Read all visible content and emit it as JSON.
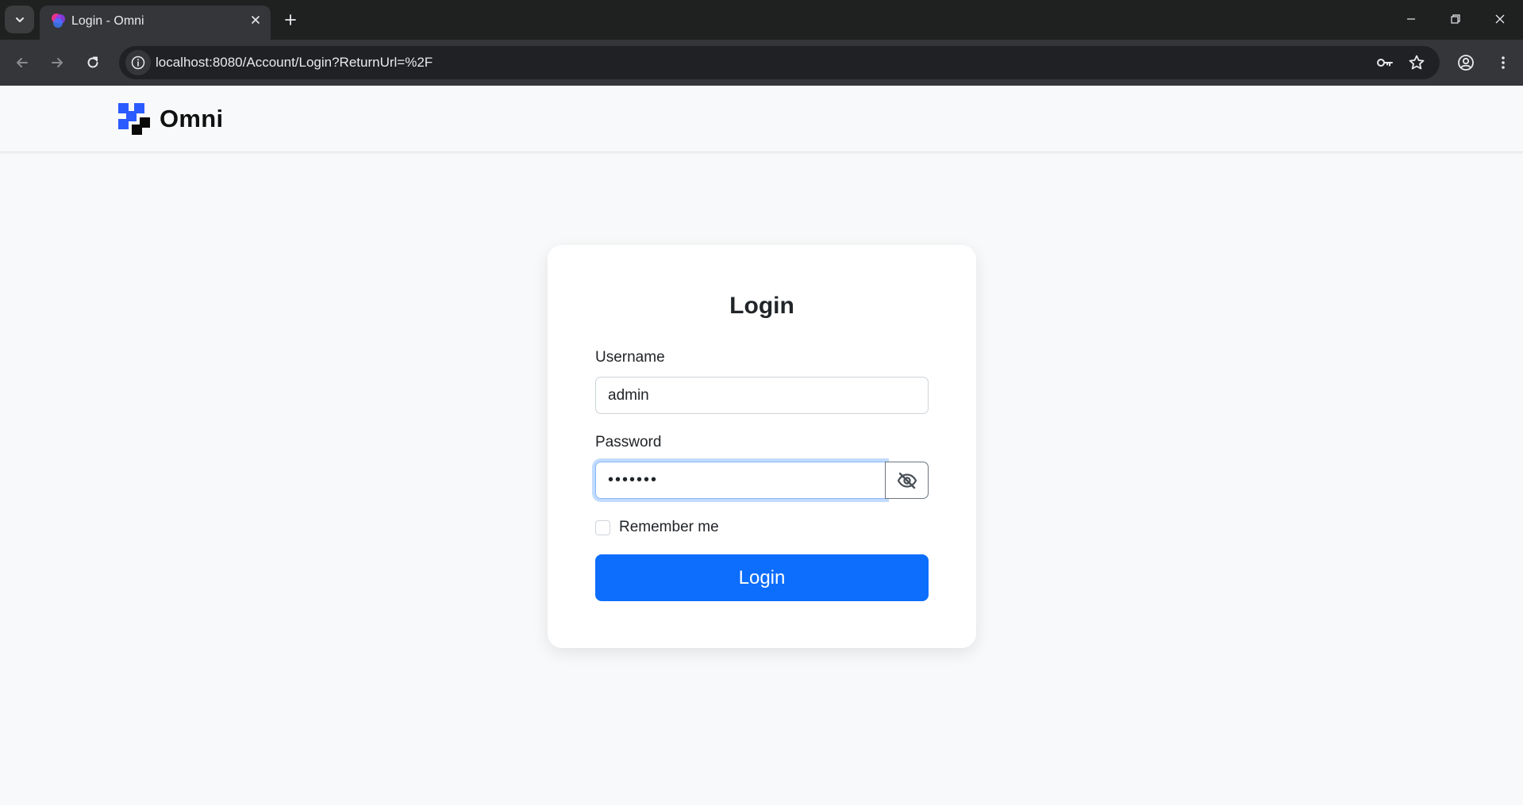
{
  "browser": {
    "tab": {
      "title": "Login - Omni"
    },
    "address_bar": {
      "url": "localhost:8080/Account/Login?ReturnUrl=%2F"
    },
    "icons": {
      "tab_search": "chevron-down-icon",
      "tab_close": "close-icon",
      "new_tab": "plus-icon",
      "minimize": "minimize-icon",
      "restore": "restore-icon",
      "window_close": "close-icon",
      "back": "arrow-left-icon",
      "forward": "arrow-right-icon",
      "reload": "reload-icon",
      "site_info": "info-icon",
      "password_manager": "key-icon",
      "bookmark": "star-icon",
      "profile": "profile-icon",
      "menu": "kebab-menu-icon"
    }
  },
  "navbar": {
    "brand": "Omni",
    "logo_colors": {
      "blue": "#2b5bff",
      "black": "#0a0a0a"
    }
  },
  "login": {
    "title": "Login",
    "username": {
      "label": "Username",
      "value": "admin"
    },
    "password": {
      "label": "Password",
      "value": "•••••••",
      "toggle_icon": "eye-slash-icon"
    },
    "remember_me": {
      "label": "Remember me",
      "checked": false
    },
    "submit_label": "Login"
  },
  "colors": {
    "accent": "#0d6efd",
    "page_background": "#f8f9fa",
    "chrome_dark": "#1f2020",
    "chrome_toolbar": "#35363a"
  }
}
